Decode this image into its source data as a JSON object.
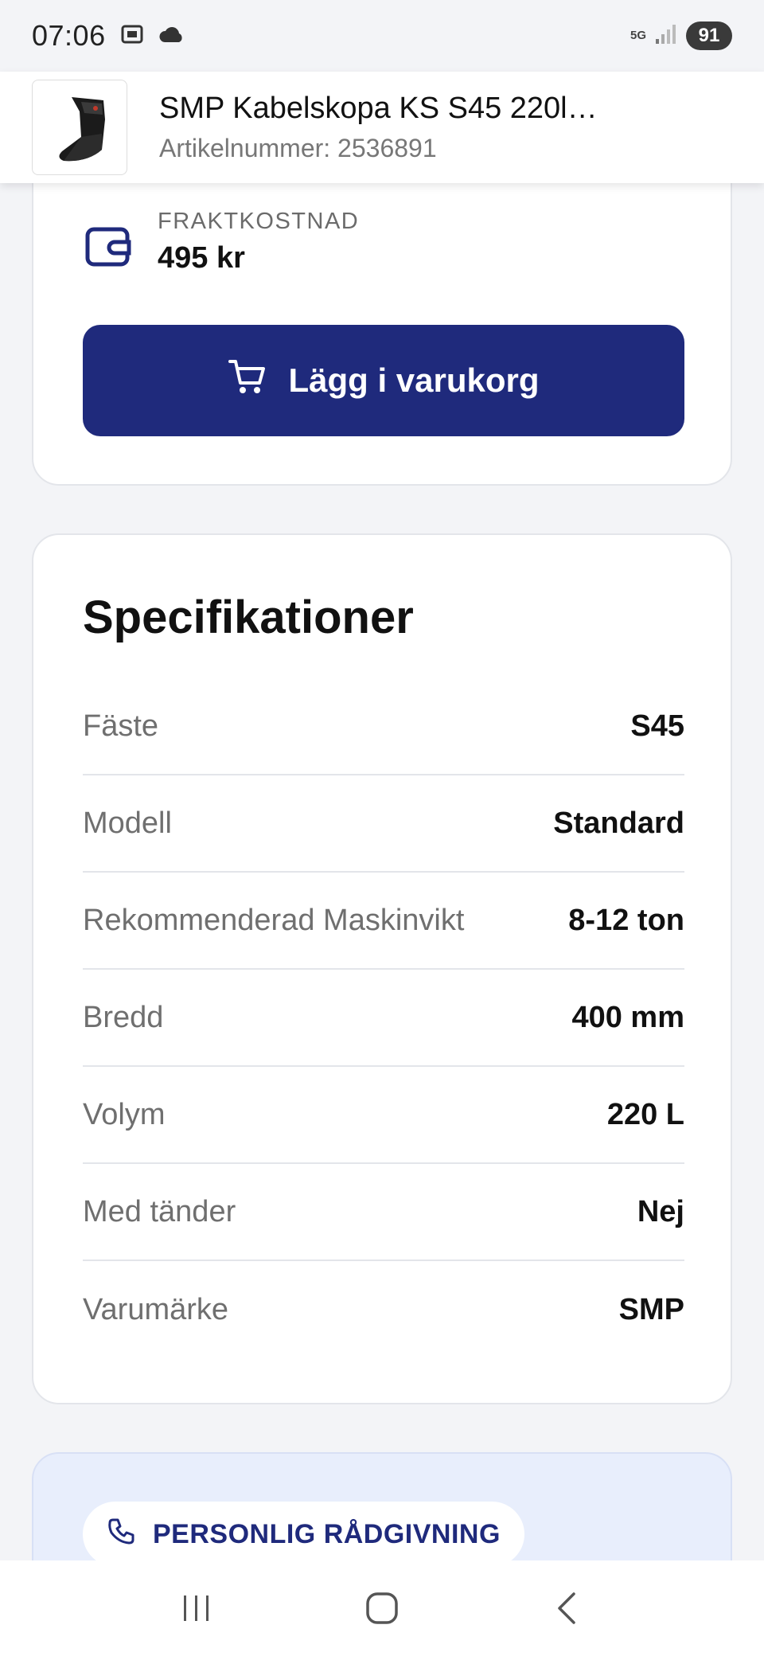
{
  "status_bar": {
    "time": "07:06",
    "network": "5G",
    "battery": "91"
  },
  "product_header": {
    "title": "SMP Kabelskopa KS S45 220l…",
    "article_number": "Artikelnummer: 2536891"
  },
  "shipping": {
    "label": "FRAKTKOSTNAD",
    "value": "495 kr"
  },
  "cart_button": {
    "label": "Lägg i varukorg"
  },
  "specifications": {
    "title": "Specifikationer",
    "rows": [
      {
        "label": "Fäste",
        "value": "S45"
      },
      {
        "label": "Modell",
        "value": "Standard"
      },
      {
        "label": "Rekommenderad Maskinvikt",
        "value": "8-12 ton"
      },
      {
        "label": "Bredd",
        "value": "400 mm"
      },
      {
        "label": "Volym",
        "value": "220 L"
      },
      {
        "label": "Med tänder",
        "value": "Nej"
      },
      {
        "label": "Varumärke",
        "value": "SMP"
      }
    ]
  },
  "advice": {
    "label": "PERSONLIG RÅDGIVNING"
  },
  "colors": {
    "brand": "#1f2a7c",
    "advice_bg": "#e8eefc"
  },
  "icons": {
    "shipping": "wallet-icon",
    "cart": "cart-icon",
    "advice": "phone-icon"
  }
}
